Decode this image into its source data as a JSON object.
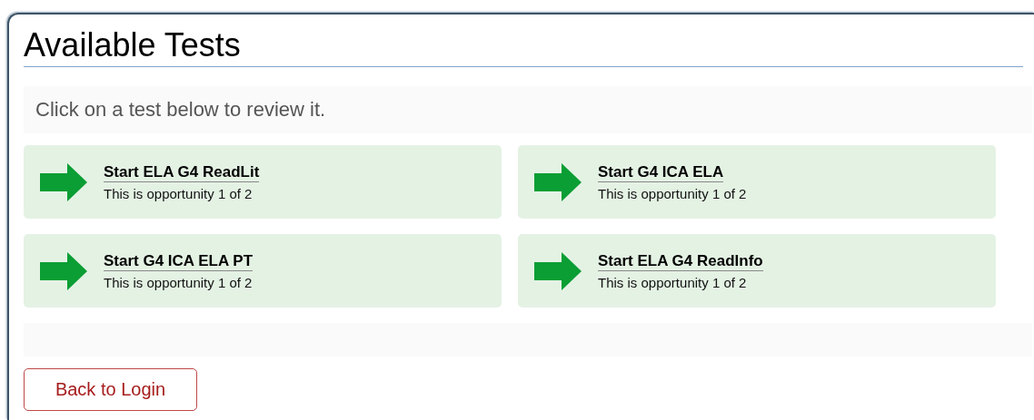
{
  "title": "Available Tests",
  "instruction": "Click on a test below to review it.",
  "tests": [
    {
      "name": "Start ELA G4 ReadLit",
      "detail": "This is opportunity 1 of 2"
    },
    {
      "name": "Start G4 ICA ELA",
      "detail": "This is opportunity 1 of 2"
    },
    {
      "name": "Start G4 ICA ELA PT",
      "detail": "This is opportunity 1 of 2"
    },
    {
      "name": "Start ELA G4 ReadInfo",
      "detail": "This is opportunity 1 of 2"
    }
  ],
  "back_button": "Back to Login"
}
